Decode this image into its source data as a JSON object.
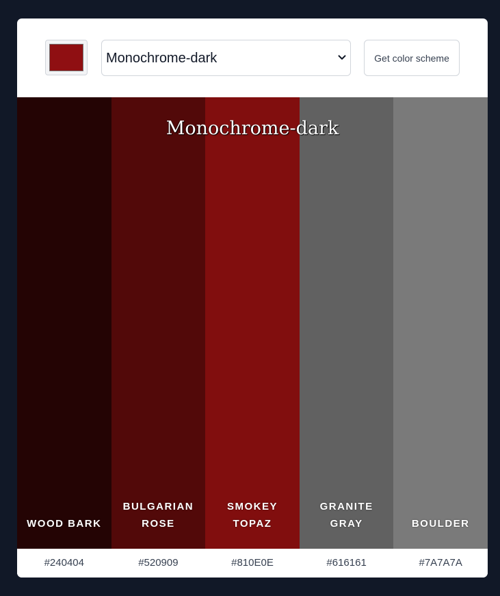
{
  "header": {
    "picker_color": "#8f0f12",
    "select_value": "Monochrome-dark",
    "button_label": "Get color scheme"
  },
  "scheme": {
    "title": "Monochrome-dark",
    "colors": [
      {
        "name_lines": [
          "WOOD BARK"
        ],
        "hex": "#240404"
      },
      {
        "name_lines": [
          "BULGARIAN",
          "ROSE"
        ],
        "hex": "#520909"
      },
      {
        "name_lines": [
          "SMOKEY",
          "TOPAZ"
        ],
        "hex": "#810E0E"
      },
      {
        "name_lines": [
          "GRANITE",
          "GRAY"
        ],
        "hex": "#616161"
      },
      {
        "name_lines": [
          "BOULDER"
        ],
        "hex": "#7A7A7A"
      }
    ]
  },
  "icons": {
    "select_chevron": "chevron-down-icon"
  }
}
